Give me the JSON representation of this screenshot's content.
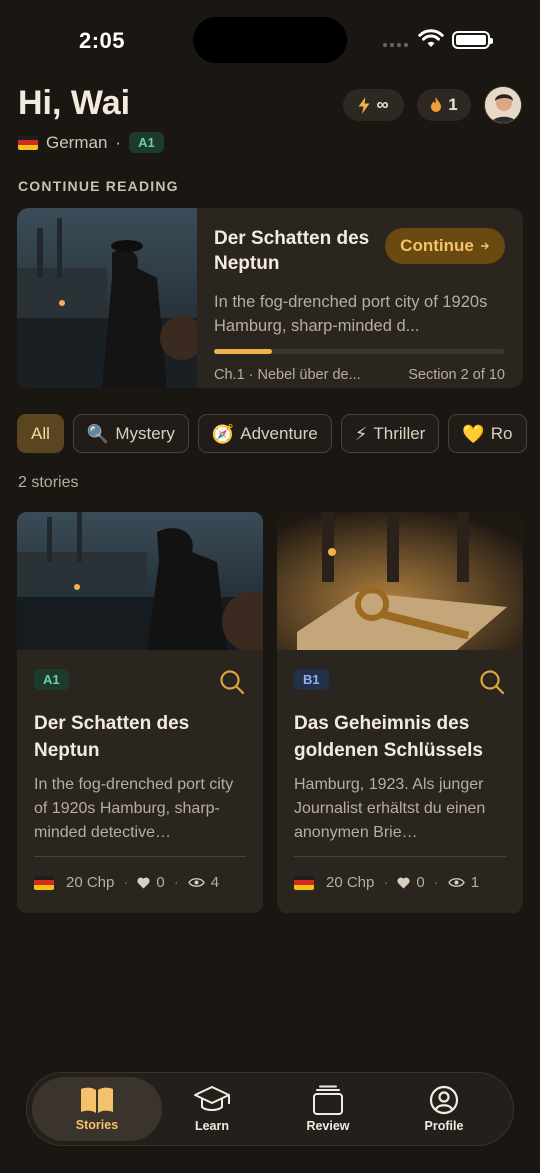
{
  "status": {
    "time": "2:05"
  },
  "header": {
    "greeting": "Hi, Wai",
    "language": "German",
    "separator": "·",
    "level": "A1",
    "energy_label": "∞",
    "streak_count": "1"
  },
  "continue_reading": {
    "section_label": "CONTINUE READING",
    "title": "Der Schatten des Neptun",
    "button_label": "Continue",
    "description": "In the fog-drenched port city of 1920s Hamburg, sharp-minded d...",
    "progress": 0.2,
    "chapter": "Ch.1 · Nebel über de...",
    "section": "Section 2 of 10"
  },
  "filters": [
    {
      "label": "All",
      "icon": ""
    },
    {
      "label": "Mystery",
      "icon": "🔍"
    },
    {
      "label": "Adventure",
      "icon": "🧭"
    },
    {
      "label": "Thriller",
      "icon": "⚡"
    },
    {
      "label": "Ro",
      "icon": "💛"
    }
  ],
  "stories_count": "2 stories",
  "stories": [
    {
      "level": "A1",
      "title": "Der Schatten des Neptun",
      "description": "In the fog-drenched port city of 1920s Hamburg, sharp-minded detective…",
      "chapters": "20 Chp",
      "likes": "0",
      "views": "4"
    },
    {
      "level": "B1",
      "title": "Das Geheimnis des goldenen Schlüssels",
      "description": "Hamburg, 1923. Als junger Journalist erhältst du einen anonymen Brie…",
      "chapters": "20 Chp",
      "likes": "0",
      "views": "1"
    }
  ],
  "nav": {
    "stories": "Stories",
    "learn": "Learn",
    "review": "Review",
    "profile": "Profile"
  },
  "colors": {
    "background": "#1a1612",
    "card": "#2a251f",
    "accent": "#f3c26a",
    "level_a1": "#6fd19b",
    "level_b1": "#8fb2ee"
  }
}
